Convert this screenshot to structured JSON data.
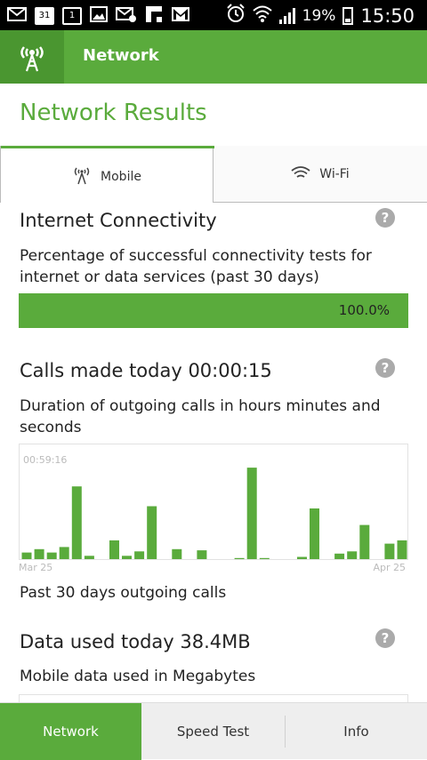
{
  "status_bar": {
    "icons": [
      "mail-icon",
      "calendar-icon",
      "calendar-icon",
      "image-icon",
      "mail-off-icon",
      "flipboard-icon",
      "gmail-icon",
      "alarm-icon",
      "wifi-icon",
      "signal-icon",
      "battery-icon"
    ],
    "calendar_day_1": "31",
    "calendar_day_2": "1",
    "battery": "19%",
    "time": "15:50"
  },
  "app_bar": {
    "title": "Network",
    "logo_icon": "antenna-icon",
    "color": "#5aab3c"
  },
  "page_title": "Network Results",
  "tabs": [
    {
      "label": "Mobile",
      "icon": "cell-tower-icon",
      "selected": true
    },
    {
      "label": "Wi-Fi",
      "icon": "wifi-icon",
      "selected": false
    }
  ],
  "internet_connectivity": {
    "title": "Internet Connectivity",
    "description": "Percentage of successful connectivity tests for internet or data services (past 30 days)",
    "percent_label": "100.0%",
    "percent": 100
  },
  "calls": {
    "title": "Calls made today 00:00:15",
    "description": "Duration of outgoing calls in hours minutes and seconds",
    "caption": "Past 30 days outgoing calls"
  },
  "chart_data": {
    "type": "bar",
    "max_label": "00:59:16",
    "x_start_label": "Mar 25",
    "x_end_label": "Apr 25",
    "values": [
      0.06,
      0.09,
      0.06,
      0.11,
      0.66,
      0.03,
      0,
      0.17,
      0.03,
      0.07,
      0.48,
      0,
      0.09,
      0,
      0.08,
      0,
      0,
      0.01,
      0.83,
      0.01,
      0,
      0,
      0.02,
      0.46,
      0,
      0.05,
      0.07,
      0.31,
      0,
      0.14,
      0.17
    ],
    "color": "#5aab3c"
  },
  "data_used": {
    "title": "Data used today 38.4MB",
    "description": "Mobile data used in Megabytes"
  },
  "bottom_nav": [
    {
      "label": "Network",
      "active": true
    },
    {
      "label": "Speed Test",
      "active": false
    },
    {
      "label": "Info",
      "active": false
    }
  ]
}
